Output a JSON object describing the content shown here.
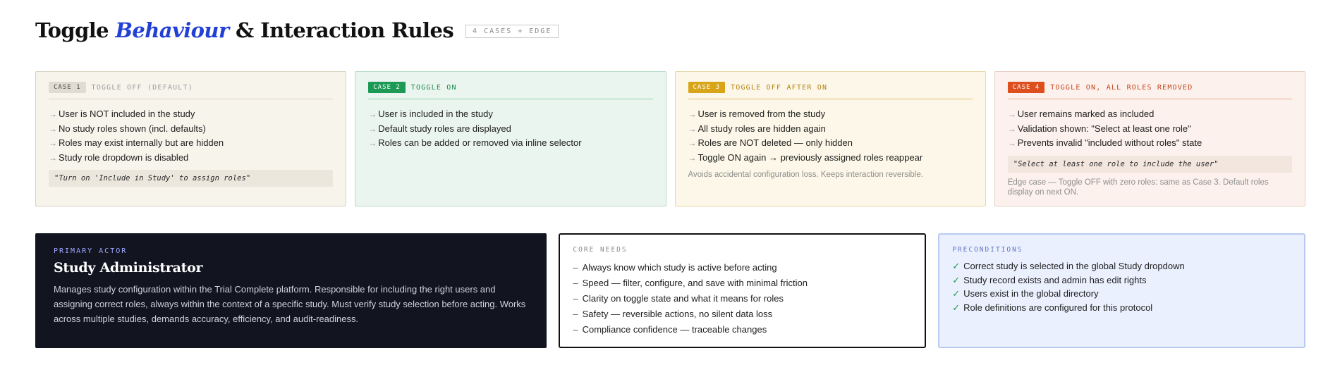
{
  "header": {
    "title_pre": "Toggle ",
    "title_accent": "Behaviour",
    "title_post": " & Interaction Rules",
    "badge": "4 CASES + EDGE"
  },
  "colors": {
    "accent": "#2340d6",
    "case1": "#e0dcd2",
    "case2": "#1c9a55",
    "case3": "#d9a518",
    "case4": "#de4f1e",
    "actor_bg": "#121520",
    "preconditions_bg": "#eaf0fd"
  },
  "cases": [
    {
      "tag": "CASE 1",
      "label": "TOGGLE OFF (DEFAULT)",
      "bullets": [
        "User is NOT included in the study",
        "No study roles shown (incl. defaults)",
        "Roles may exist internally but are hidden",
        "Study role dropdown is disabled"
      ],
      "quote": "\"Turn on 'Include in Study' to assign roles\""
    },
    {
      "tag": "CASE 2",
      "label": "TOGGLE ON",
      "bullets": [
        "User is included in the study",
        "Default study roles are displayed",
        "Roles can be added or removed via inline selector"
      ]
    },
    {
      "tag": "CASE 3",
      "label": "TOGGLE OFF AFTER ON",
      "bullets": [
        "User is removed from the study",
        "All study roles are hidden again",
        "Roles are NOT deleted — only hidden",
        "Toggle ON again → previously assigned roles reappear"
      ],
      "note": "Avoids accidental configuration loss. Keeps interaction reversible."
    },
    {
      "tag": "CASE 4",
      "label": "TOGGLE ON, ALL ROLES REMOVED",
      "bullets": [
        "User remains marked as included",
        "Validation shown: \"Select at least one role\"",
        "Prevents invalid \"included without roles\" state"
      ],
      "quote": "\"Select at least one role to include the user\"",
      "note": "Edge case — Toggle OFF with zero roles: same as Case 3. Default roles display on next ON."
    }
  ],
  "actor": {
    "eyebrow": "PRIMARY ACTOR",
    "title": "Study Administrator",
    "description": "Manages study configuration within the Trial Complete platform. Responsible for including the right users and assigning correct roles, always within the context of a specific study. Must verify study selection before acting. Works across multiple studies, demands accuracy, efficiency, and audit-readiness."
  },
  "needs": {
    "eyebrow": "CORE NEEDS",
    "items": [
      "Always know which study is active before acting",
      "Speed — filter, configure, and save with minimal friction",
      "Clarity on toggle state and what it means for roles",
      "Safety — reversible actions, no silent data loss",
      "Compliance confidence — traceable changes"
    ]
  },
  "preconditions": {
    "eyebrow": "PRECONDITIONS",
    "items": [
      "Correct study is selected in the global Study dropdown",
      "Study record exists and admin has edit rights",
      "Users exist in the global directory",
      "Role definitions are configured for this protocol"
    ]
  }
}
